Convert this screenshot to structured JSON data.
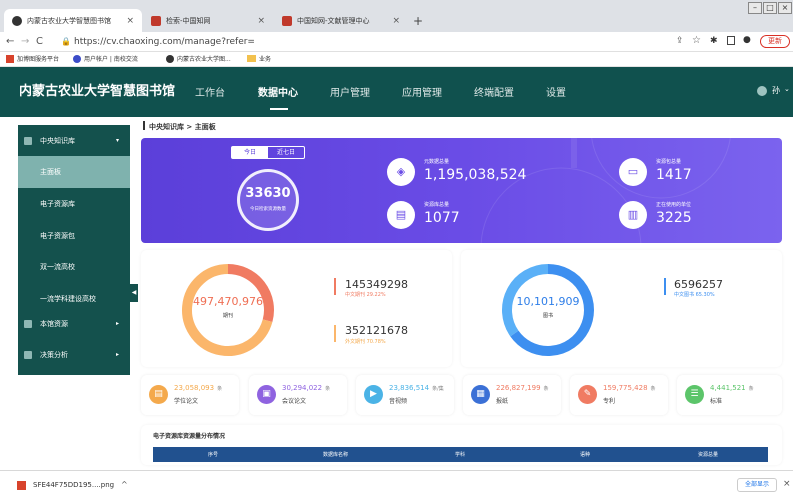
{
  "browser": {
    "tabs": [
      {
        "title": "内蒙古农业大学智慧图书馆",
        "active": true
      },
      {
        "title": "检索-中国知网",
        "active": false
      },
      {
        "title": "中国知网-文献管理中心",
        "active": false
      }
    ],
    "new_tab": "+",
    "url": "https://cv.chaoxing.com/manage?refer=",
    "update_label": "更新",
    "bookmarks": [
      "加博图服务平台",
      "用户帐户 | 南校交流",
      "内蒙古农业大学图...",
      "业务"
    ]
  },
  "app": {
    "title": "内蒙古农业大学智慧图书馆",
    "nav": [
      "工作台",
      "数据中心",
      "用户管理",
      "应用管理",
      "终端配置",
      "设置"
    ],
    "active_nav": "数据中心",
    "user": "孙"
  },
  "sidebar": {
    "groups": [
      {
        "label": "中央知识库",
        "expanded": true
      },
      {
        "label": "本馆资源"
      },
      {
        "label": "决策分析"
      }
    ],
    "items": [
      "主面板",
      "电子资源库",
      "电子资源包",
      "双一流高校",
      "一流学科建设高校"
    ],
    "active": "主面板"
  },
  "breadcrumb": "中央知识库 > 主面板",
  "banner": {
    "toggle": [
      "今日",
      "近七日"
    ],
    "main_value": "33630",
    "main_label": "今日检索资源数量",
    "metrics": [
      {
        "label": "元数据总量",
        "value": "1,195,038,524"
      },
      {
        "label": "资源库总量",
        "value": "1077"
      },
      {
        "label": "资源包总量",
        "value": "1417"
      },
      {
        "label": "正在使用的单位",
        "value": "3225"
      }
    ]
  },
  "chart_data": [
    {
      "type": "pie",
      "title": "",
      "center_value": "497,470,976",
      "center_label": "期刊",
      "slices": [
        {
          "label": "中文期刊",
          "value": 145349298,
          "value_text": "145349298",
          "percent": 29.22,
          "percent_text": "中文期刊 29.22%",
          "color": "#f07b62"
        },
        {
          "label": "外文期刊",
          "value": 352121678,
          "value_text": "352121678",
          "percent": 70.78,
          "percent_text": "外文期刊 70.78%",
          "color": "#fbb66b"
        }
      ]
    },
    {
      "type": "pie",
      "title": "",
      "center_value": "10,101,909",
      "center_label": "图书",
      "slices": [
        {
          "label": "中文图书",
          "value": 6596257,
          "value_text": "6596257",
          "percent": 65.3,
          "percent_text": "中文图书 65.30%",
          "color": "#3d8ff0"
        },
        {
          "label": "",
          "value": 3505652,
          "percent": 34.7,
          "color": "#5ab0f7"
        }
      ]
    }
  ],
  "stats": [
    {
      "value": "23,058,093",
      "unit": "条",
      "label": "学位论文",
      "color": "#f4a94c"
    },
    {
      "value": "30,294,022",
      "unit": "条",
      "label": "会议论文",
      "color": "#8f63e0"
    },
    {
      "value": "23,836,514",
      "unit": "条/集",
      "label": "音视频",
      "color": "#4bb3e6"
    },
    {
      "value": "226,827,199",
      "unit": "条",
      "label": "报纸",
      "color": "#3b70d6"
    },
    {
      "value": "159,775,428",
      "unit": "条",
      "label": "专利",
      "color": "#f07b62"
    },
    {
      "value": "4,441,521",
      "unit": "条",
      "label": "标准",
      "color": "#5cc56a"
    }
  ],
  "resource_table": {
    "title": "电子资源库资源量分布情况",
    "columns": [
      "序号",
      "数据库名称",
      "学科",
      "语种",
      "资源总量"
    ]
  },
  "download": {
    "file": "SFE44F75DD195....png",
    "show_all": "全部显示"
  }
}
